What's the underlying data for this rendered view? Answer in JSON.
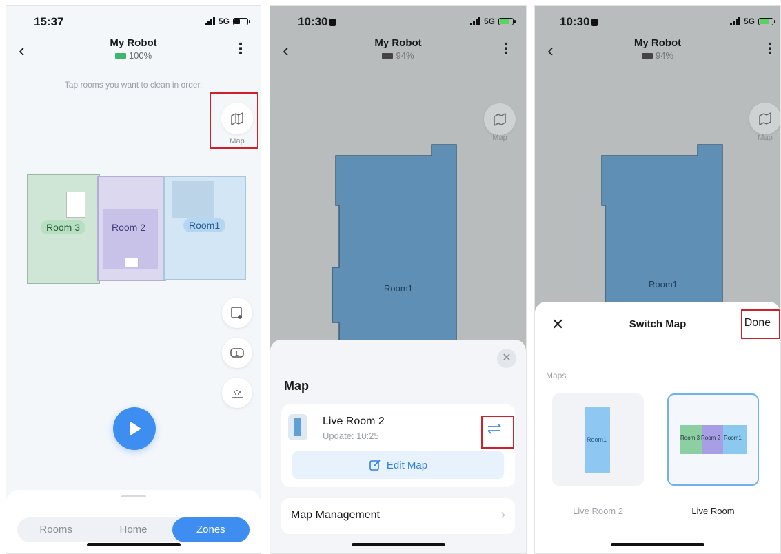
{
  "screen1": {
    "time": "15:37",
    "network": "5G",
    "title": "My Robot",
    "battery": "100%",
    "hint": "Tap rooms you want to clean in order.",
    "map_label": "Map",
    "rooms": [
      "Room 3",
      "Room 2",
      "Room1"
    ],
    "tabs": [
      "Rooms",
      "Home",
      "Zones"
    ],
    "active_tab": "Zones"
  },
  "screen2": {
    "time": "10:30",
    "network": "5G",
    "title": "My Robot",
    "battery": "94%",
    "map_label": "Map",
    "room_label": "Room1",
    "sheet_title": "Map",
    "map_name": "Live Room 2",
    "map_update": "Update: 10:25",
    "edit_label": "Edit Map",
    "management_label": "Map Management"
  },
  "screen3": {
    "time": "10:30",
    "network": "5G",
    "title": "My Robot",
    "battery": "94%",
    "map_label": "Map",
    "room_label": "Room1",
    "sheet_title": "Switch Map",
    "done_label": "Done",
    "section_label": "Maps",
    "maps": [
      {
        "name": "Live Room 2",
        "selected": false,
        "rooms": [
          "Room1"
        ]
      },
      {
        "name": "Live Room",
        "selected": true,
        "rooms": [
          "Room 3",
          "Room 2",
          "Room1"
        ]
      }
    ]
  },
  "colors": {
    "accent": "#3e8df0",
    "highlight": "#d0202a",
    "room1_dark": "#6f9fc3",
    "room3": "#cfe5d6",
    "room2": "#dcd8f0",
    "room1_light": "#d2e6f5"
  }
}
